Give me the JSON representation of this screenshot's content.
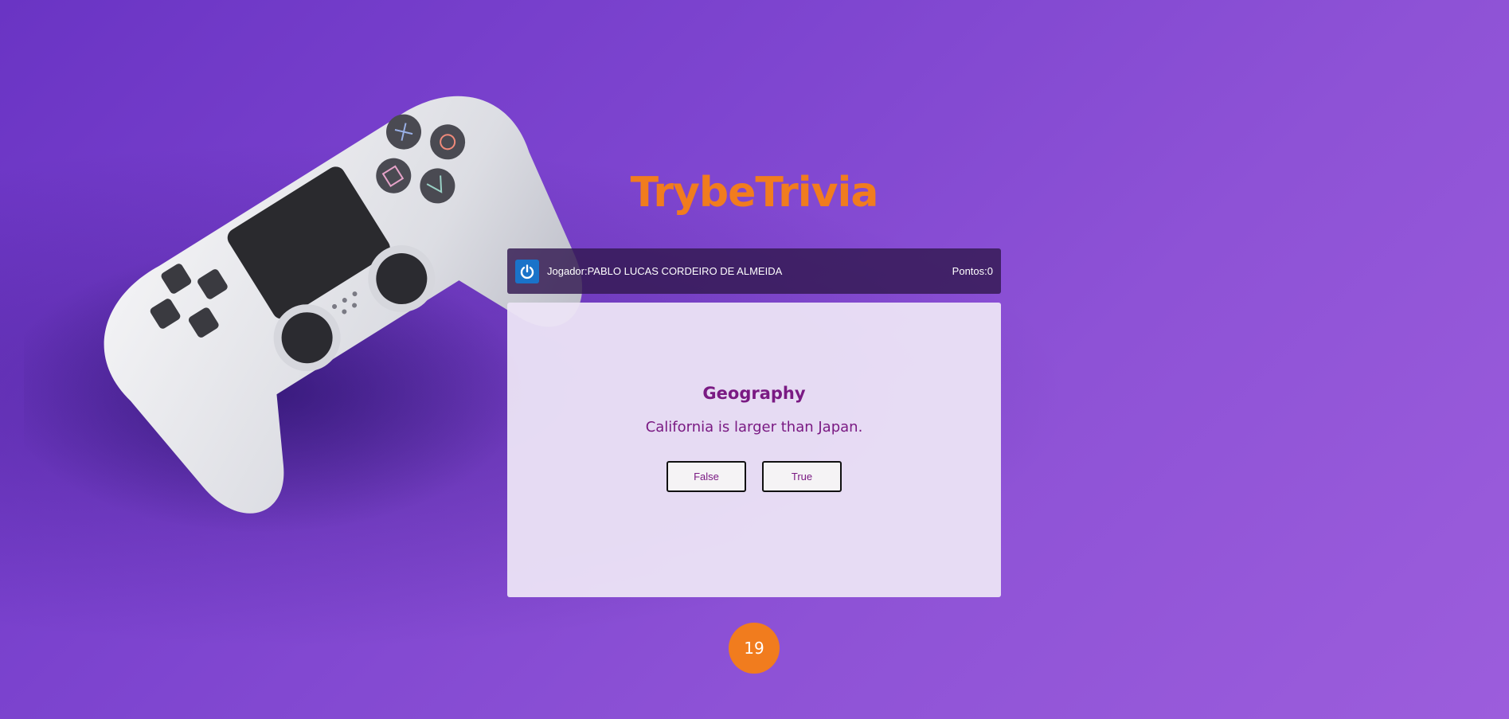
{
  "app": {
    "title": "TrybeTrivia"
  },
  "header": {
    "player_label": "Jogador:PABLO LUCAS CORDEIRO DE ALMEIDA",
    "score_label": "Pontos:0",
    "avatar_icon": "power-icon"
  },
  "question": {
    "category": "Geography",
    "text": "California is larger than Japan.",
    "answers": [
      "False",
      "True"
    ]
  },
  "timer": {
    "seconds": "19"
  },
  "colors": {
    "accent": "#f17c1e",
    "question_text": "#7a1a83",
    "header_bg": "#321950",
    "avatar_bg": "#1a73c9"
  },
  "decor": {
    "background_image": "game-controller"
  }
}
